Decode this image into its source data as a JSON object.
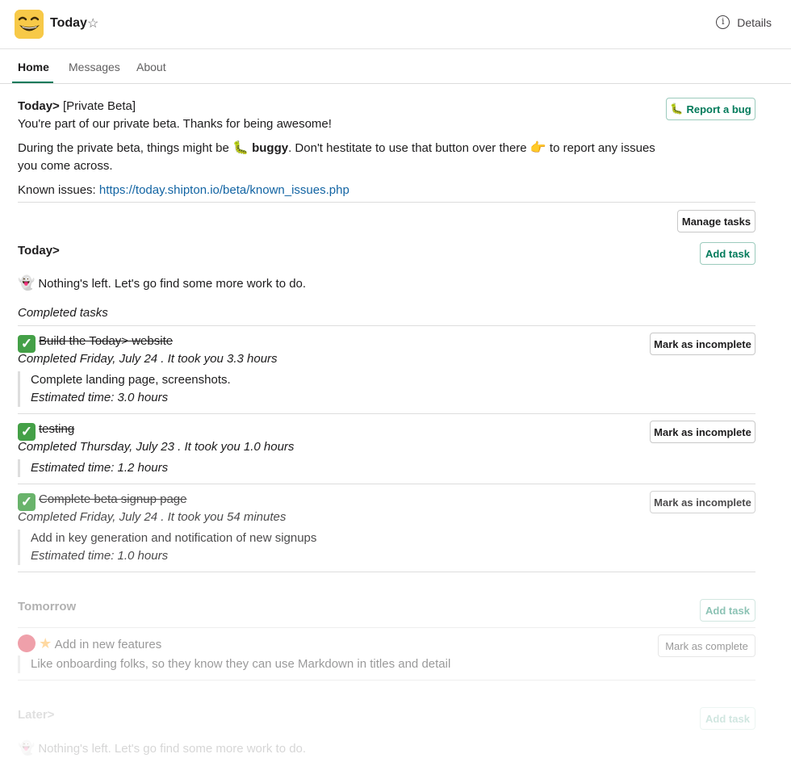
{
  "header": {
    "title": "Today",
    "details_label": "Details"
  },
  "tabs": [
    {
      "label": "Home"
    },
    {
      "label": "Messages"
    },
    {
      "label": "About"
    }
  ],
  "beta": {
    "heading": "Today>",
    "heading_suffix": "[Private Beta]",
    "line1": "You're part of our private beta. Thanks for being awesome!",
    "line2_a": "During the private beta, things might be",
    "line2_bold": "buggy",
    "line2_b": ". Don't hestitate to use that button over there",
    "line2_c": "to report any issues",
    "line3": "you come across.",
    "known_label": "Known issues:",
    "known_url": "https://today.shipton.io/beta/known_issues.php",
    "report_button": "Report a bug"
  },
  "manage_button": "Manage tasks",
  "today": {
    "heading": "Today>",
    "add_button": "Add task",
    "empty_message": "Nothing's left. Let's go find some more work to do.",
    "completed_heading": "Completed tasks",
    "completed": [
      {
        "title": "Build the Today> website",
        "meta": "Completed Friday, July 24 . It took you 3.3 hours",
        "note": "Complete landing page, screenshots.",
        "estimate": "Estimated time: 3.0 hours",
        "button": "Mark as incomplete"
      },
      {
        "title": "testing",
        "meta": "Completed Thursday, July 23 . It took you 1.0 hours",
        "estimate": "Estimated time: 1.2 hours",
        "button": "Mark as incomplete"
      },
      {
        "title": "Complete beta signup page",
        "meta": "Completed Friday, July 24 . It took you 54 minutes",
        "note": "Add in key generation and notification of new signups",
        "estimate": "Estimated time: 1.0 hours",
        "button": "Mark as incomplete"
      }
    ]
  },
  "tomorrow": {
    "heading": "Tomorrow",
    "add_button": "Add task",
    "task_title": "Add in new features",
    "task_note": "Like onboarding folks, so they know they can use Markdown in titles and detail",
    "complete_button": "Mark as complete"
  },
  "later": {
    "heading": "Later>",
    "add_button": "Add task",
    "empty_message": "Nothing's left. Let's go find some more work to do."
  },
  "icons": {
    "app_icon": "grinning-face-icon",
    "star": "star-outline-icon",
    "info": "info-circle-icon",
    "bug": "caterpillar-bug-icon",
    "pointing": "pointing-right-hand-icon",
    "ghost": "ghost-icon",
    "check": "check-mark-box-icon",
    "red_circle": "red-circle-icon",
    "star_filled": "star-icon"
  },
  "colors": {
    "accent": "#007a5a",
    "link": "#1264a3",
    "check": "#44a047"
  }
}
